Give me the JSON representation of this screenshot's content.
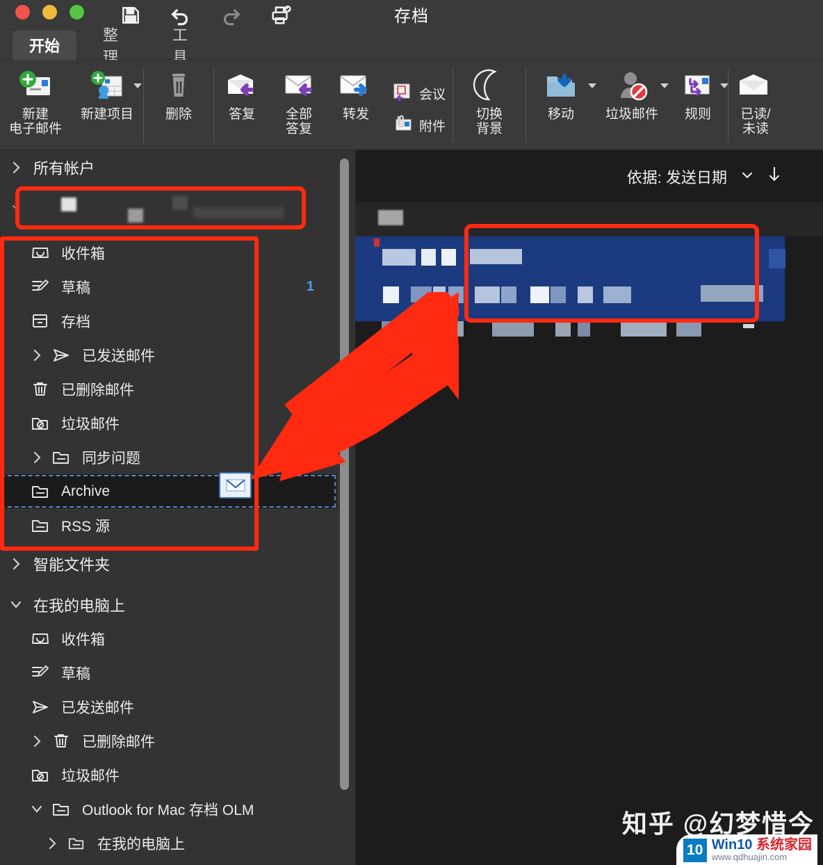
{
  "window": {
    "title": "存档",
    "quick_access": [
      {
        "name": "save-icon",
        "label": "保存"
      },
      {
        "name": "undo-icon",
        "label": "撤消"
      },
      {
        "name": "redo-icon",
        "label": "恢复"
      },
      {
        "name": "print-preview-icon",
        "label": "打印预览"
      }
    ]
  },
  "tabs": [
    {
      "label": "开始",
      "active": true
    },
    {
      "label": "整理",
      "active": false
    },
    {
      "label": "工具",
      "active": false
    }
  ],
  "ribbon": {
    "items": [
      {
        "label": "新建\n电子邮件",
        "icon": "new-email-icon",
        "dropdown": false
      },
      {
        "label": "新建项目",
        "icon": "new-item-icon",
        "dropdown": true
      },
      {
        "label": "删除",
        "icon": "trash-icon",
        "dropdown": false
      },
      {
        "label": "答复",
        "icon": "reply-icon",
        "dropdown": false
      },
      {
        "label": "全部\n答复",
        "icon": "reply-all-icon",
        "dropdown": false
      },
      {
        "label": "转发",
        "icon": "forward-icon",
        "dropdown": false
      },
      {
        "label": "切换\n背景",
        "icon": "moon-icon",
        "dropdown": false
      },
      {
        "label": "移动",
        "icon": "move-folder-icon",
        "dropdown": true
      },
      {
        "label": "垃圾邮件",
        "icon": "junk-mail-icon",
        "dropdown": true
      },
      {
        "label": "规则",
        "icon": "rules-icon",
        "dropdown": true
      },
      {
        "label": "已读/\n未读",
        "icon": "read-unread-icon",
        "dropdown": false
      }
    ],
    "stacked": [
      {
        "label": "会议",
        "icon": "meeting-icon"
      },
      {
        "label": "附件",
        "icon": "attachment-icon"
      }
    ]
  },
  "sidebar": {
    "groups": [
      {
        "label": "所有帐户",
        "expanded": false,
        "icon": "chevron-right-icon"
      },
      {
        "label": "智能文件夹",
        "expanded": false,
        "icon": "chevron-right-icon"
      },
      {
        "label": "在我的电脑上",
        "expanded": true,
        "icon": "chevron-down-icon"
      }
    ],
    "account_folders": [
      {
        "label": "收件箱",
        "icon": "inbox-icon",
        "chevron": "",
        "badge": ""
      },
      {
        "label": "草稿",
        "icon": "drafts-icon",
        "chevron": "",
        "badge": "1"
      },
      {
        "label": "存档",
        "icon": "archive-box-icon",
        "chevron": "",
        "badge": ""
      },
      {
        "label": "已发送邮件",
        "icon": "sent-icon",
        "chevron": "right",
        "badge": ""
      },
      {
        "label": "已删除邮件",
        "icon": "trash-icon",
        "chevron": "",
        "badge": ""
      },
      {
        "label": "垃圾邮件",
        "icon": "junk-folder-icon",
        "chevron": "",
        "badge": ""
      },
      {
        "label": "同步问题",
        "icon": "folder-icon",
        "chevron": "right",
        "badge": ""
      },
      {
        "label": "Archive",
        "icon": "folder-icon",
        "chevron": "",
        "badge": "",
        "drop_target": true
      },
      {
        "label": "RSS 源",
        "icon": "folder-icon",
        "chevron": "",
        "badge": ""
      }
    ],
    "oncomputer_folders": [
      {
        "label": "收件箱",
        "icon": "inbox-icon",
        "chevron": "",
        "indent": 1
      },
      {
        "label": "草稿",
        "icon": "drafts-icon",
        "chevron": "",
        "indent": 1
      },
      {
        "label": "已发送邮件",
        "icon": "sent-icon",
        "chevron": "",
        "indent": 1
      },
      {
        "label": "已删除邮件",
        "icon": "trash-icon",
        "chevron": "right",
        "indent": 1
      },
      {
        "label": "垃圾邮件",
        "icon": "junk-folder-icon",
        "chevron": "",
        "indent": 1
      },
      {
        "label": "Outlook for Mac 存档 OLM",
        "icon": "folder-icon",
        "chevron": "down",
        "indent": 1
      },
      {
        "label": "在我的电脑上",
        "icon": "folder-icon",
        "chevron": "right",
        "indent": 2
      }
    ]
  },
  "maillist": {
    "sort_label": "依据: 发送日期",
    "sort_caret_icon": "chevron-down-icon",
    "sort_direction_icon": "arrow-down-icon",
    "selected_row_redacted": true
  },
  "drag": {
    "badge_icon": "envelope-icon"
  },
  "annotations": {
    "accent_color": "#ff2a10",
    "drop_outline_color": "#5a85c4",
    "selected_row_color": "#1b3a80",
    "badge_color": "#4d9bea"
  },
  "watermarks": {
    "zhihu": "知乎 @幻梦惜今",
    "win10_badge": "10",
    "win10_name_a": "Win",
    "win10_name_b": "10",
    "win10_name_c": "系统家园",
    "win10_url": "www.qdhuajin.com"
  }
}
